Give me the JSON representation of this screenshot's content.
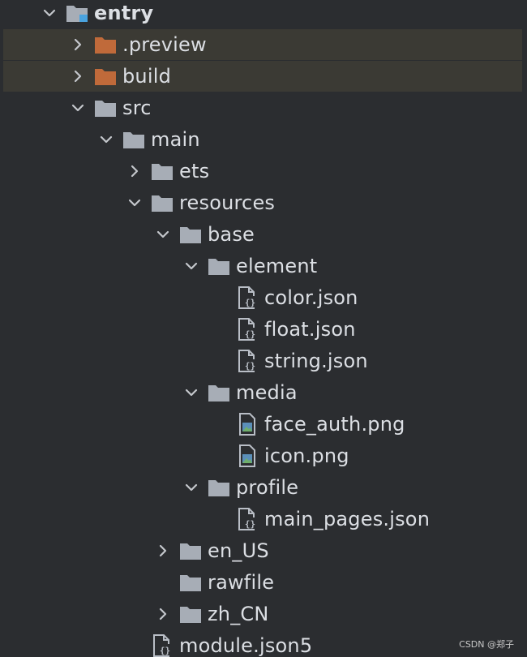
{
  "colors": {
    "background": "#2b2d30",
    "excluded_row": "#3b3a34",
    "folder": "#a7adb6",
    "excluded_folder": "#c06a3a",
    "text": "#dcdfe4",
    "module_badge": "#4aa3df"
  },
  "tree": [
    {
      "label": "entry",
      "depth": 0,
      "arrow": "expanded",
      "icon": "module-folder-icon",
      "bold": true,
      "excluded": false
    },
    {
      "label": ".preview",
      "depth": 1,
      "arrow": "collapsed",
      "icon": "excluded-folder-icon",
      "bold": false,
      "excluded": true
    },
    {
      "label": "build",
      "depth": 1,
      "arrow": "collapsed",
      "icon": "excluded-folder-icon",
      "bold": false,
      "excluded": true
    },
    {
      "label": "src",
      "depth": 1,
      "arrow": "expanded",
      "icon": "folder-icon",
      "bold": false,
      "excluded": false
    },
    {
      "label": "main",
      "depth": 2,
      "arrow": "expanded",
      "icon": "folder-icon",
      "bold": false,
      "excluded": false
    },
    {
      "label": "ets",
      "depth": 3,
      "arrow": "collapsed",
      "icon": "folder-icon",
      "bold": false,
      "excluded": false
    },
    {
      "label": "resources",
      "depth": 3,
      "arrow": "expanded",
      "icon": "folder-icon",
      "bold": false,
      "excluded": false
    },
    {
      "label": "base",
      "depth": 4,
      "arrow": "expanded",
      "icon": "folder-icon",
      "bold": false,
      "excluded": false
    },
    {
      "label": "element",
      "depth": 5,
      "arrow": "expanded",
      "icon": "folder-icon",
      "bold": false,
      "excluded": false
    },
    {
      "label": "color.json",
      "depth": 6,
      "arrow": "none",
      "icon": "json-file-icon",
      "bold": false,
      "excluded": false
    },
    {
      "label": "float.json",
      "depth": 6,
      "arrow": "none",
      "icon": "json-file-icon",
      "bold": false,
      "excluded": false
    },
    {
      "label": "string.json",
      "depth": 6,
      "arrow": "none",
      "icon": "json-file-icon",
      "bold": false,
      "excluded": false
    },
    {
      "label": "media",
      "depth": 5,
      "arrow": "expanded",
      "icon": "folder-icon",
      "bold": false,
      "excluded": false
    },
    {
      "label": "face_auth.png",
      "depth": 6,
      "arrow": "none",
      "icon": "image-file-icon",
      "bold": false,
      "excluded": false
    },
    {
      "label": "icon.png",
      "depth": 6,
      "arrow": "none",
      "icon": "image-file-icon",
      "bold": false,
      "excluded": false
    },
    {
      "label": "profile",
      "depth": 5,
      "arrow": "expanded",
      "icon": "folder-icon",
      "bold": false,
      "excluded": false
    },
    {
      "label": "main_pages.json",
      "depth": 6,
      "arrow": "none",
      "icon": "json-file-icon",
      "bold": false,
      "excluded": false
    },
    {
      "label": "en_US",
      "depth": 4,
      "arrow": "collapsed",
      "icon": "folder-icon",
      "bold": false,
      "excluded": false
    },
    {
      "label": "rawfile",
      "depth": 4,
      "arrow": "none",
      "icon": "folder-icon",
      "bold": false,
      "excluded": false
    },
    {
      "label": "zh_CN",
      "depth": 4,
      "arrow": "collapsed",
      "icon": "folder-icon",
      "bold": false,
      "excluded": false
    },
    {
      "label": "module.json5",
      "depth": 3,
      "arrow": "none",
      "icon": "json-file-icon",
      "bold": false,
      "excluded": false
    }
  ],
  "watermark": "CSDN @郑子"
}
